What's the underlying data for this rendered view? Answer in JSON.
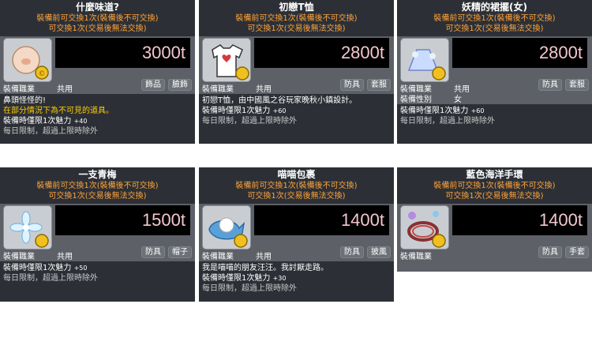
{
  "common": {
    "note1": "裝備前可交換1次(裝備後不可交換)",
    "note2": "可交換1次(交易後無法交換)",
    "job_label": "裝備職業",
    "job_value": "共用",
    "daily_limit": "每日限制，超過上限時除外"
  },
  "items": [
    {
      "name": "什麼味道?",
      "price": "3000t",
      "tags": [
        "飾品",
        "臉飾"
      ],
      "desc1": "鼻頭怪怪的!",
      "warn": "在部分情況下為不可見的道具。",
      "stat": "裝備時僅限1次魅力",
      "stat_value": "+40",
      "icon": "round-mask-icon"
    },
    {
      "name": "初戀T恤",
      "price": "2800t",
      "tags": [
        "防具",
        "套服"
      ],
      "desc1": "初戀T恤，由中國風之谷玩家晚秋小鎮設計。",
      "stat": "裝備時僅限1次魅力",
      "stat_value": "+60",
      "icon": "heart-tshirt-icon"
    },
    {
      "name": "妖精的裙擺(女)",
      "price": "2800t",
      "tags": [
        "防具",
        "套服"
      ],
      "gender_label": "裝備性別",
      "gender_value": "女",
      "stat": "裝備時僅限1次魅力",
      "stat_value": "+60",
      "icon": "fairy-dress-icon"
    },
    {
      "name": "一支青梅",
      "price": "1500t",
      "tags": [
        "防具",
        "帽子"
      ],
      "stat": "裝備時僅限1次魅力",
      "stat_value": "+50",
      "icon": "blue-flower-icon"
    },
    {
      "name": "喵喵包裹",
      "price": "1400t",
      "tags": [
        "防具",
        "披風"
      ],
      "desc1": "我是喵喵的朋友汪汪。我討厭走路。",
      "stat": "裝備時僅限1次魅力",
      "stat_value": "+30",
      "icon": "cat-wrap-icon"
    },
    {
      "name": "藍色海洋手環",
      "price": "1400t",
      "tags": [
        "防具",
        "手套"
      ],
      "icon": "ocean-bracelet-icon"
    }
  ]
}
